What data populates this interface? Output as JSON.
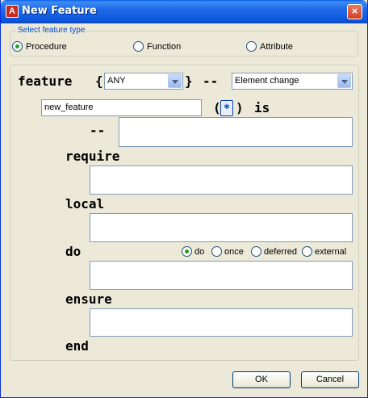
{
  "window": {
    "title": "New Feature",
    "app_icon": "A",
    "close_glyph": "×"
  },
  "feature_type": {
    "label": "Select feature type",
    "options": [
      {
        "label": "Procedure",
        "checked": true
      },
      {
        "label": "Function",
        "checked": false
      },
      {
        "label": "Attribute",
        "checked": false
      }
    ]
  },
  "editor": {
    "kw_feature": "feature",
    "brace_open": "{",
    "brace_close": "}",
    "comment_dashes": "--",
    "export_value": "ANY",
    "category_value": "Element change",
    "name_value": "new_feature",
    "paren_open": "(",
    "paren_close": ")",
    "args_glyph": "*",
    "kw_is": "is",
    "kw_require": "require",
    "kw_local": "local",
    "kw_do": "do",
    "kw_ensure": "ensure",
    "kw_end": "end",
    "body_options": [
      {
        "label": "do",
        "checked": true
      },
      {
        "label": "once",
        "checked": false
      },
      {
        "label": "deferred",
        "checked": false
      },
      {
        "label": "external",
        "checked": false
      }
    ]
  },
  "buttons": {
    "ok": "OK",
    "cancel": "Cancel"
  }
}
